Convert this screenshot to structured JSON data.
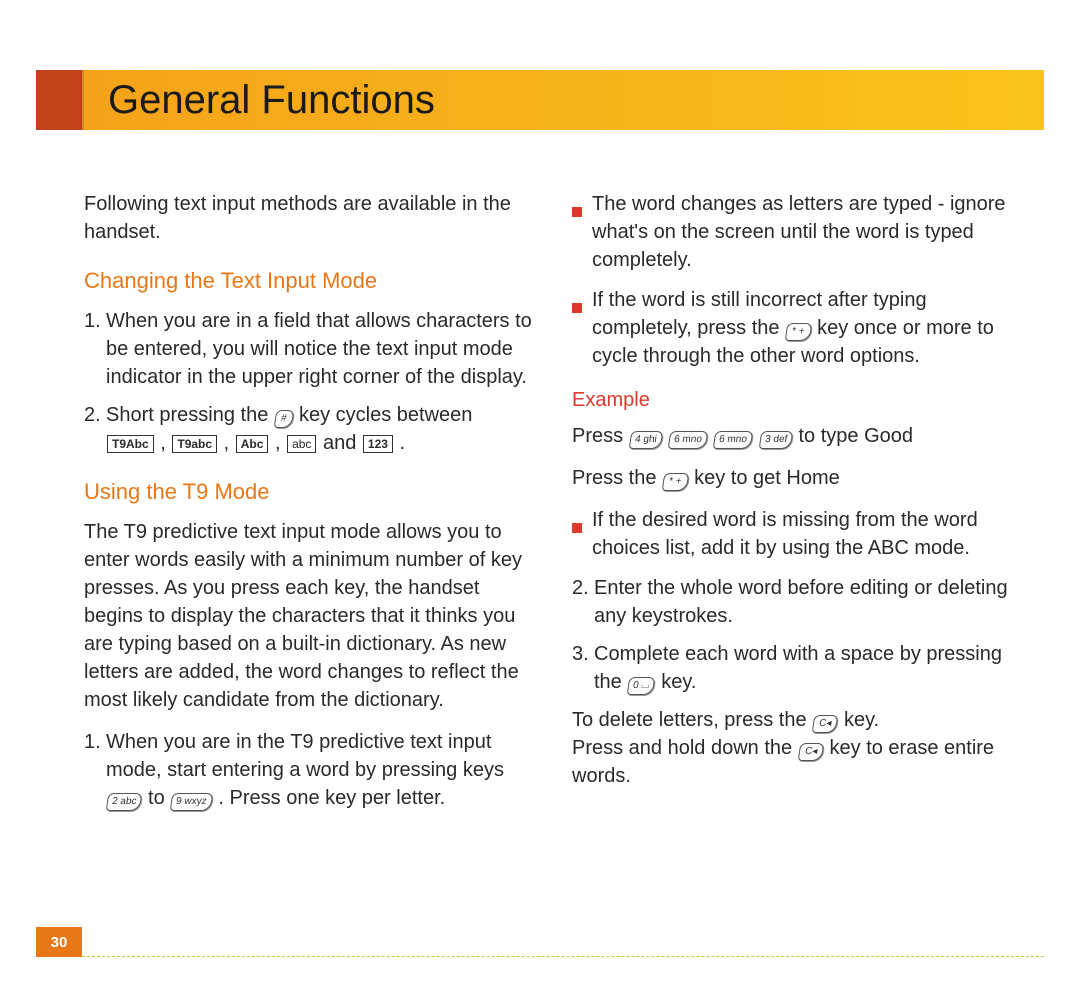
{
  "header": {
    "title": "General Functions"
  },
  "page_number": "30",
  "left": {
    "intro": "Following text input methods are available in the handset.",
    "sec1_title": "Changing the Text Input Mode",
    "sec1_item1": "When you are in a field that allows characters to be entered, you will notice the text input mode indicator in the upper right corner of the display.",
    "sec1_item2a": "Short pressing the ",
    "sec1_item2b": " key cycles between ",
    "sec1_item2_and": " and ",
    "sec1_item2_period": " .",
    "sec2_title": "Using the T9 Mode",
    "sec2_para": "The T9 predictive text input mode allows you to enter words easily with a minimum number of key presses. As you press each key, the handset begins to display the characters that it thinks you are typing based on a built-in dictionary. As new letters are added, the word changes to reflect the most likely candidate from the dictionary.",
    "sec2_item1a": "When you are in the T9 predictive text input mode, start entering a word by pressing keys ",
    "sec2_item1b": " to ",
    "sec2_item1c": " . Press one key per letter."
  },
  "right": {
    "b1": "The word changes as letters are typed - ignore what's on the screen until the word is typed completely.",
    "b2a": "If the word is still incorrect after typing completely, press the ",
    "b2b": " key once or more to cycle through the other word options.",
    "ex_title": "Example",
    "ex_l1a": "Press ",
    "ex_l1b": " to type Good",
    "ex_l2a": "Press the ",
    "ex_l2b": " key to get Home",
    "b3": "If the desired word is missing from the word choices list, add it by using the ABC mode.",
    "item2": "Enter the whole word before editing or deleting any keystrokes.",
    "item3a": "Complete each word with a space by pressing the ",
    "item3b": " key.",
    "tail1a": "To delete letters, press the ",
    "tail1b": " key.",
    "tail2a": "Press and hold down the ",
    "tail2b": " key to erase entire words."
  },
  "keys": {
    "hash": "#",
    "star": "* +",
    "two": "2 abc",
    "nine": "9 wxyz",
    "four": "4 ghi",
    "six": "6 mno",
    "three": "3 def",
    "zero": "0 ⌴",
    "clear": "C◂"
  },
  "modes": {
    "m1": "T9Abc",
    "m2": "T9abc",
    "m3": "Abc",
    "m4": "abc",
    "m5": "123"
  }
}
